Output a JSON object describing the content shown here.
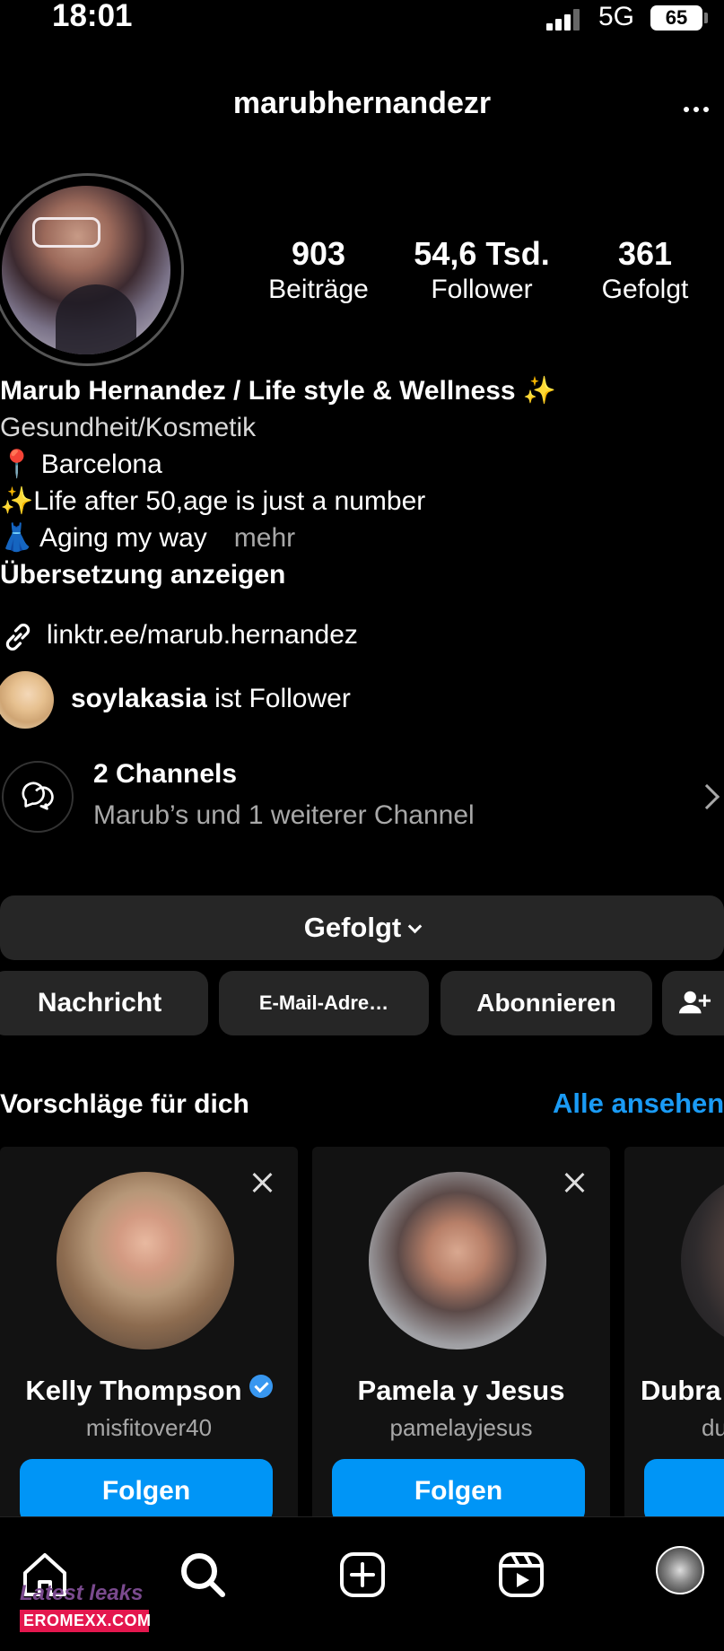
{
  "status_bar": {
    "time": "18:01",
    "network": "5G",
    "battery": "65"
  },
  "header": {
    "username": "marubhernandezr"
  },
  "stats": [
    {
      "value": "903",
      "label": "Beiträge"
    },
    {
      "value": "54,6 Tsd.",
      "label": "Follower"
    },
    {
      "value": "361",
      "label": "Gefolgt"
    }
  ],
  "bio": {
    "name": "Marub Hernandez / Life style & Wellness ✨",
    "category": "Gesundheit/Kosmetik",
    "lines": [
      "📍 Barcelona",
      "✨Life after 50,age is just a number",
      "👗 Aging my way"
    ],
    "more": "mehr",
    "translate": "Übersetzung anzeigen"
  },
  "link": {
    "url": "linktr.ee/marub.hernandez"
  },
  "followed_by": {
    "user": "soylakasia",
    "suffix": " ist Follower"
  },
  "channels": {
    "title": "2 Channels",
    "subtitle": "Marub’s und 1 weiterer Channel"
  },
  "buttons": {
    "following": "Gefolgt",
    "message": "Nachricht",
    "email": "E-Mail-Adre…",
    "subscribe": "Abonnieren"
  },
  "suggestions": {
    "title": "Vorschläge für dich",
    "see_all": "Alle ansehen",
    "cards": [
      {
        "name": "Kelly Thompson",
        "handle": "misfitover40",
        "verified": true,
        "follow": "Folgen"
      },
      {
        "name": "Pamela y Jesus",
        "handle": "pamelayjesus",
        "verified": false,
        "follow": "Folgen"
      },
      {
        "name": "Dubra",
        "handle": "du",
        "verified": false,
        "follow": ""
      }
    ]
  },
  "watermark": {
    "top": "Latest leaks",
    "bottom": "EROMEXX.COM"
  },
  "colors": {
    "accent": "#0095f6",
    "link": "#1a9bf5",
    "button_bg": "#262626",
    "background": "#000000"
  }
}
